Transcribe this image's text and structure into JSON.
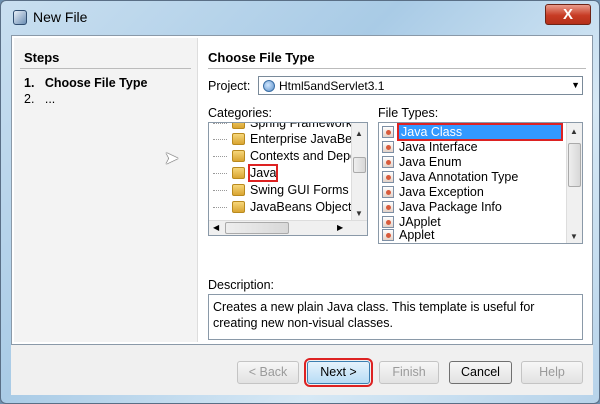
{
  "window": {
    "title": "New File",
    "close_label": "X"
  },
  "steps": {
    "heading": "Steps",
    "items": [
      {
        "num": "1.",
        "label": "Choose File Type"
      },
      {
        "num": "2.",
        "label": "..."
      }
    ]
  },
  "main": {
    "heading": "Choose File Type",
    "project_label": "Project:",
    "project_value": "Html5andServlet3.1",
    "categories_label": "Categories:",
    "categories": [
      "Spring Framework",
      "Enterprise JavaBeans",
      "Contexts and Dependency Injection",
      "Java",
      "Swing GUI Forms",
      "JavaBeans Objects"
    ],
    "selected_category": "Java",
    "file_types_label": "File Types:",
    "file_types": [
      "Java Class",
      "Java Interface",
      "Java Enum",
      "Java Annotation Type",
      "Java Exception",
      "Java Package Info",
      "JApplet",
      "Applet"
    ],
    "selected_file_type": "Java Class",
    "description_label": "Description:",
    "description": "Creates a new plain Java class. This template is useful for creating new non-visual classes."
  },
  "buttons": {
    "back": "< Back",
    "next": "Next >",
    "finish": "Finish",
    "cancel": "Cancel",
    "help": "Help"
  },
  "colors": {
    "selection": "#3399ff",
    "highlight_box": "#dd2222",
    "close_button": "#c73b24"
  }
}
